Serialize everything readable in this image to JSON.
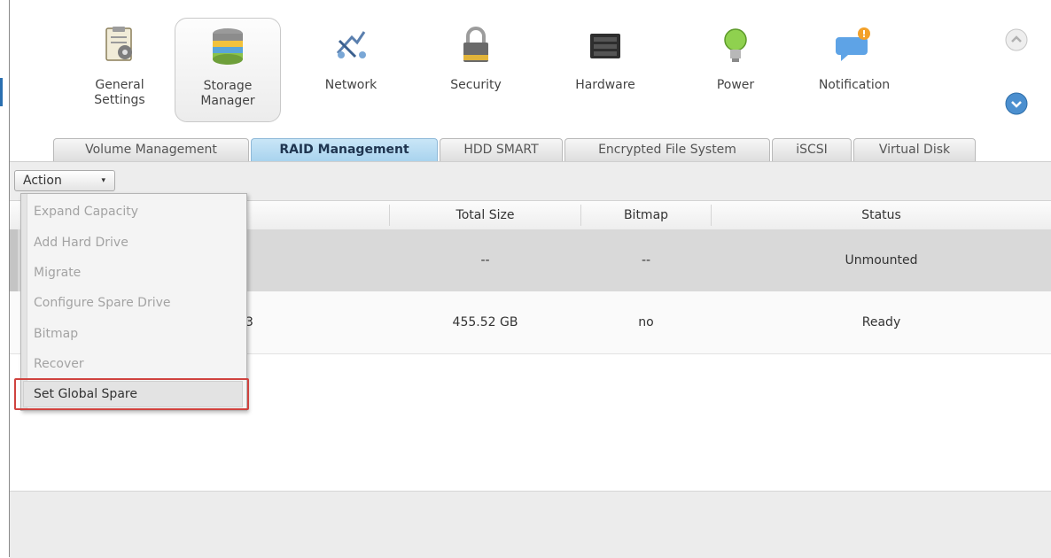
{
  "nav": {
    "items": [
      {
        "label": "General\nSettings",
        "icon": "general-settings-icon"
      },
      {
        "label": "Storage\nManager",
        "icon": "storage-manager-icon",
        "active": true
      },
      {
        "label": "Network",
        "icon": "network-icon"
      },
      {
        "label": "Security",
        "icon": "security-lock-icon"
      },
      {
        "label": "Hardware",
        "icon": "hardware-icon"
      },
      {
        "label": "Power",
        "icon": "power-bulb-icon"
      },
      {
        "label": "Notification",
        "icon": "notification-icon"
      }
    ]
  },
  "tabs": [
    "Volume Management",
    "RAID Management",
    "HDD SMART",
    "Encrypted File System",
    "iSCSI",
    "Virtual Disk"
  ],
  "active_tab": "RAID Management",
  "toolbar": {
    "action_label": "Action",
    "caret": "▾"
  },
  "table": {
    "columns": [
      "Total Size",
      "Bitmap",
      "Status"
    ],
    "rows": [
      {
        "name_partial": "",
        "total_size": "--",
        "bitmap": "--",
        "status": "Unmounted"
      },
      {
        "name_partial": "3",
        "total_size": "455.52 GB",
        "bitmap": "no",
        "status": "Ready"
      }
    ]
  },
  "action_menu": {
    "items": [
      {
        "label": "Expand Capacity",
        "enabled": false
      },
      {
        "label": "Add Hard Drive",
        "enabled": false
      },
      {
        "label": "Migrate",
        "enabled": false
      },
      {
        "label": "Configure Spare Drive",
        "enabled": false
      },
      {
        "label": "Bitmap",
        "enabled": false
      },
      {
        "label": "Recover",
        "enabled": false
      },
      {
        "label": "Set Global Spare",
        "enabled": true,
        "highlighted": true
      }
    ]
  },
  "colors": {
    "active_tab_bg": "#b6dbf2",
    "highlight_border": "#d0433f",
    "selected_row": "#d9d9d9"
  }
}
